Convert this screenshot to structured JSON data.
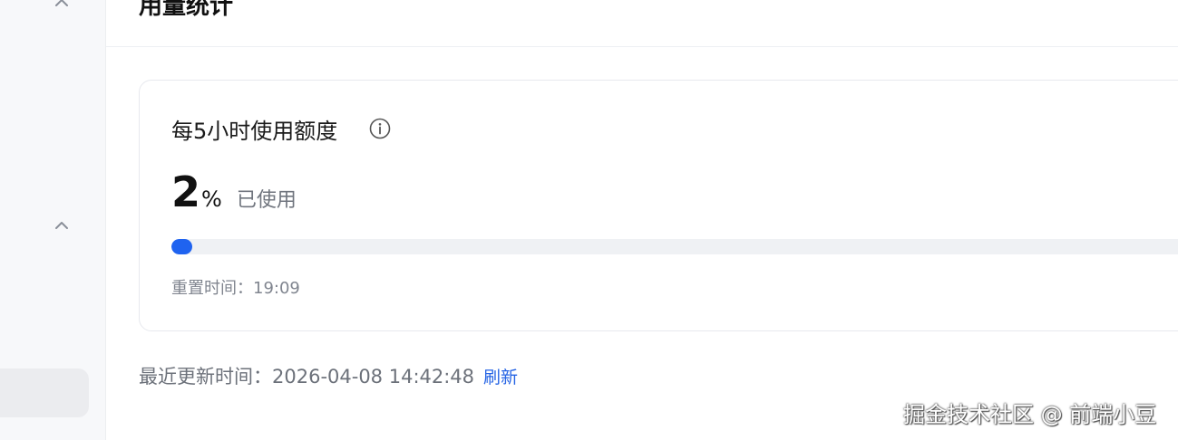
{
  "header": {
    "title": "用量统计"
  },
  "usage_card": {
    "title": "每5小时使用额度",
    "info_icon": "info-circle-icon",
    "percent_value": "2",
    "percent_sign": "%",
    "used_label": "已使用",
    "progress_fraction": 0.02,
    "reset_time_label": "重置时间：19:09"
  },
  "footer": {
    "last_updated_label": "最近更新时间：2026-04-08 14:42:48",
    "refresh_label": "刷新"
  },
  "watermark": "掘金技术社区 @ 前端小豆",
  "colors": {
    "accent": "#1f63f0",
    "link": "#2463e4",
    "track": "#eff1f4"
  }
}
